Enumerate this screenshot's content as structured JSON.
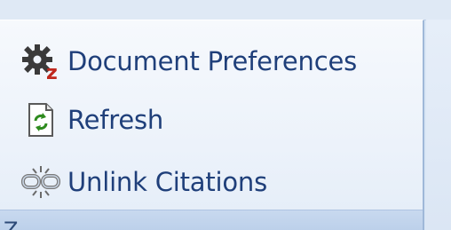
{
  "ribbon": {
    "commands": [
      {
        "label": "Document Preferences",
        "icon": "gear-with-z-icon"
      },
      {
        "label": "Refresh",
        "icon": "refresh-document-icon"
      },
      {
        "label": "Unlink Citations",
        "icon": "broken-link-icon"
      }
    ],
    "group_label_partial": "Z"
  },
  "colors": {
    "text": "#1f3f7a",
    "z_red": "#c0281e",
    "refresh_green": "#2e8b1e"
  }
}
